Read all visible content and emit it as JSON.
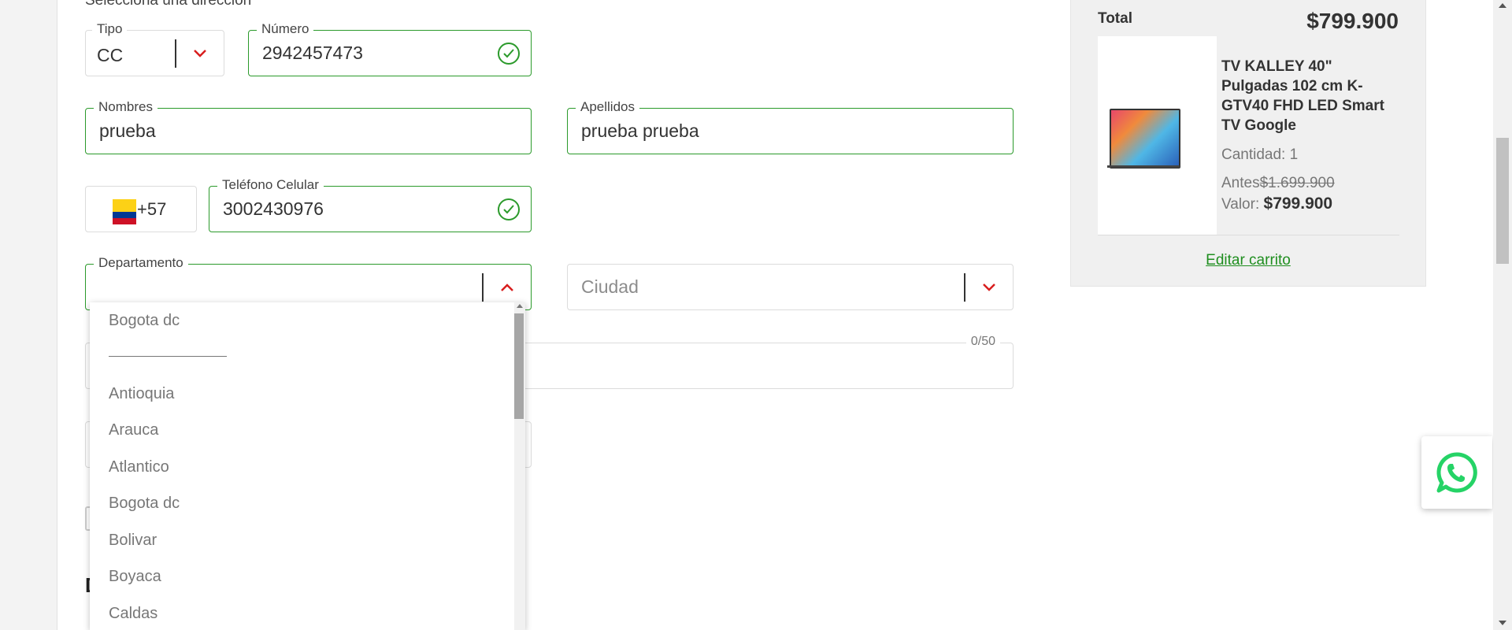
{
  "form": {
    "section_title": "Selecciona una dirección",
    "tipo": {
      "label": "Tipo",
      "value": "CC"
    },
    "numero": {
      "label": "Número",
      "value": "2942457473"
    },
    "nombres": {
      "label": "Nombres",
      "value": "prueba"
    },
    "apellidos": {
      "label": "Apellidos",
      "value": "prueba prueba"
    },
    "phone_prefix": "+57",
    "telefono": {
      "label": "Teléfono Celular",
      "value": "3002430976"
    },
    "departamento": {
      "label": "Departamento",
      "value": ""
    },
    "ciudad": {
      "placeholder": "Ciudad"
    },
    "address_counter": "0/50",
    "next_section_initial": "D"
  },
  "dropdown": {
    "featured": "Bogota dc",
    "items": [
      "Antioquia",
      "Arauca",
      "Atlantico",
      "Bogota dc",
      "Bolivar",
      "Boyaca",
      "Caldas"
    ]
  },
  "summary": {
    "total_label": "Total",
    "total_value": "$799.900",
    "product": {
      "name": "TV KALLEY 40\" Pulgadas 102 cm K-GTV40 FHD LED Smart TV Google",
      "quantity": "Cantidad: 1",
      "before_label": "Antes",
      "before_price": "$1.699.900",
      "value_label": "Valor:",
      "value_price": "$799.900"
    },
    "edit_cart": "Editar carrito"
  },
  "colors": {
    "accent_green": "#2b9a2b",
    "chevron_red": "#d81e1e",
    "whatsapp_green": "#25d366"
  },
  "icons": [
    "check-circle-icon",
    "chevron-down-icon",
    "chevron-up-icon",
    "colombia-flag-icon",
    "whatsapp-icon"
  ]
}
